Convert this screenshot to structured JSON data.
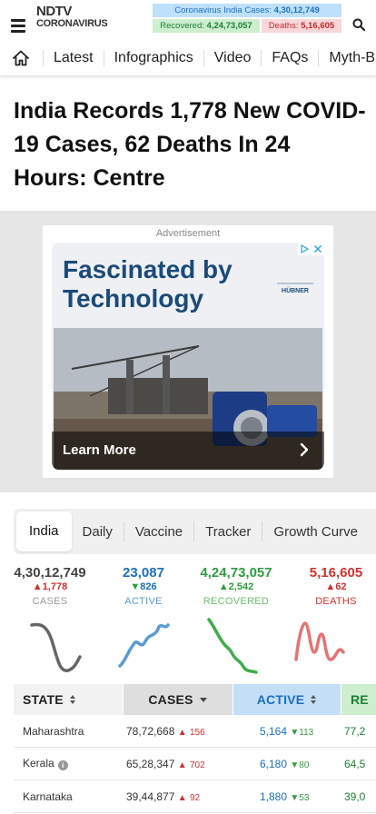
{
  "header": {
    "logo_top": "NDTV",
    "logo_bottom": "CORONAVIRUS",
    "stats": {
      "india_cases_label": "Coronavirus India Cases:",
      "india_cases_value": "4,30,12,749",
      "recovered_label": "Recovered:",
      "recovered_value": "4,24,73,057",
      "deaths_label": "Deaths:",
      "deaths_value": "5,16,605"
    }
  },
  "nav": {
    "items": [
      "Latest",
      "Infographics",
      "Video",
      "FAQs",
      "Myth-Busters"
    ]
  },
  "headline": "India Records 1,778 New COVID-19 Cases, 62 Deaths In 24 Hours: Centre",
  "ad": {
    "label": "Advertisement",
    "title": "Fascinated by Technology",
    "brand": "HÜBNER",
    "cta": "Learn More"
  },
  "tracker": {
    "tabs": [
      "India",
      "Daily",
      "Vaccine",
      "Tracker",
      "Growth Curve"
    ],
    "summary": {
      "cases": {
        "value": "4,30,12,749",
        "delta": "1,778",
        "label": "CASES"
      },
      "active": {
        "value": "23,087",
        "delta": "826",
        "label": "ACTIVE"
      },
      "recovered": {
        "value": "4,24,73,057",
        "delta": "2,542",
        "label": "RECOVERED"
      },
      "deaths": {
        "value": "5,16,605",
        "delta": "62",
        "label": "DEATHS"
      }
    },
    "colors": {
      "cases": "#555555",
      "active": "#1b6fc1",
      "recovered": "#2e9e3e",
      "deaths": "#d32f2f"
    },
    "table": {
      "headers": {
        "state": "STATE",
        "cases": "CASES",
        "active": "ACTIVE",
        "recovered": "RE"
      },
      "rows": [
        {
          "state": "Maharashtra",
          "cases": "78,72,668",
          "cases_delta": "156",
          "active": "5,164",
          "active_delta": "113",
          "recovered": "77,2"
        },
        {
          "state": "Kerala",
          "cases": "65,28,347",
          "cases_delta": "702",
          "active": "6,180",
          "active_delta": "80",
          "recovered": "64,5"
        },
        {
          "state": "Karnataka",
          "cases": "39,44,877",
          "cases_delta": "92",
          "active": "1,880",
          "active_delta": "53",
          "recovered": "39,0"
        }
      ]
    }
  }
}
